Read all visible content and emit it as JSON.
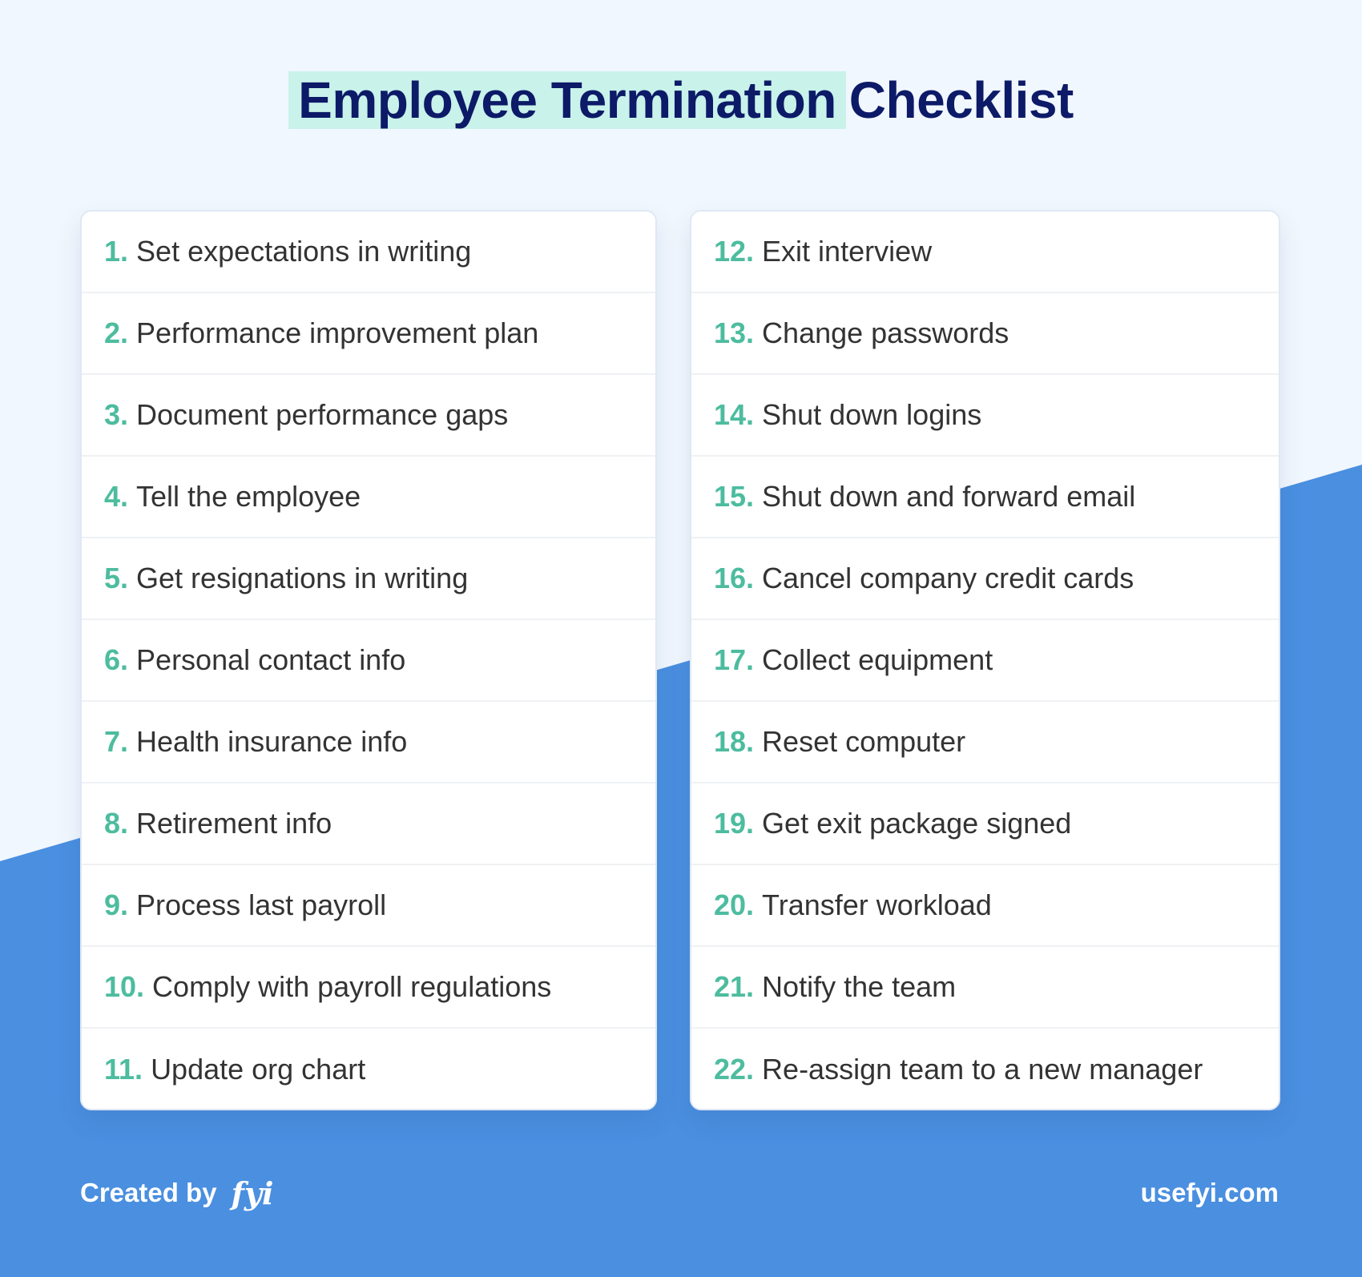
{
  "title": {
    "highlighted": "Employee Termination",
    "rest": "Checklist"
  },
  "colors": {
    "background": "#f1f7fe",
    "accent_blue": "#4a8fe0",
    "number_teal": "#4dbc9f",
    "title_navy": "#0c1a67",
    "highlight_mint": "#c8f2ea",
    "item_text": "#333333"
  },
  "checklist": {
    "left": [
      {
        "num": "1.",
        "text": "Set expectations in writing"
      },
      {
        "num": "2.",
        "text": "Performance improvement plan"
      },
      {
        "num": "3.",
        "text": "Document performance gaps"
      },
      {
        "num": "4.",
        "text": "Tell the employee"
      },
      {
        "num": "5.",
        "text": "Get resignations in writing"
      },
      {
        "num": "6.",
        "text": "Personal contact info"
      },
      {
        "num": "7.",
        "text": "Health insurance info"
      },
      {
        "num": "8.",
        "text": "Retirement info"
      },
      {
        "num": "9.",
        "text": "Process last payroll"
      },
      {
        "num": "10.",
        "text": "Comply with payroll regulations"
      },
      {
        "num": "11.",
        "text": "Update org chart"
      }
    ],
    "right": [
      {
        "num": "12.",
        "text": "Exit interview"
      },
      {
        "num": "13.",
        "text": "Change passwords"
      },
      {
        "num": "14.",
        "text": "Shut down logins"
      },
      {
        "num": "15.",
        "text": "Shut down and forward email"
      },
      {
        "num": "16.",
        "text": "Cancel company credit cards"
      },
      {
        "num": "17.",
        "text": "Collect equipment"
      },
      {
        "num": "18.",
        "text": "Reset computer"
      },
      {
        "num": "19.",
        "text": "Get exit package signed"
      },
      {
        "num": "20.",
        "text": "Transfer workload"
      },
      {
        "num": "21.",
        "text": "Notify the team"
      },
      {
        "num": "22.",
        "text": "Re-assign team to a new manager"
      }
    ]
  },
  "footer": {
    "created_by": "Created by",
    "logo": "fyi",
    "website": "usefyi.com"
  }
}
